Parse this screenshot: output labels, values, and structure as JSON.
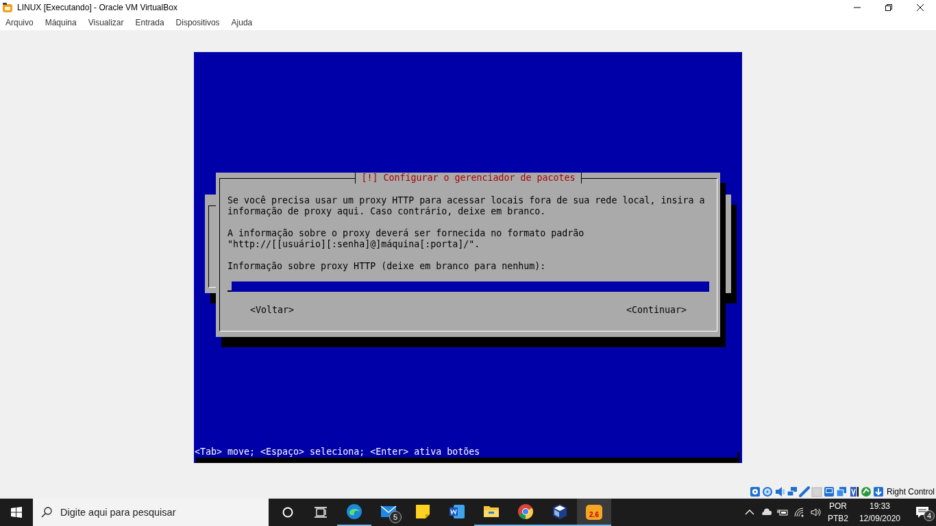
{
  "window": {
    "title": "LINUX [Executando] - Oracle VM VirtualBox"
  },
  "menu": [
    "Arquivo",
    "Máquina",
    "Visualizar",
    "Entrada",
    "Dispositivos",
    "Ajuda"
  ],
  "installer": {
    "title": "[!] Configurar o gerenciador de pacotes",
    "paragraphs": [
      "Se você precisa usar um proxy HTTP para acessar locais fora de sua rede local, insira a\ninformação de proxy aqui. Caso contrário, deixe em branco.",
      "A informação sobre o proxy deverá ser fornecida no formato padrão\n\"http://[[usuário][:senha]@]máquina[:porta]/\"."
    ],
    "field_label": "Informação sobre proxy HTTP (deixe em branco para nenhum):",
    "buttons": [
      "<Voltar>",
      "<Continuar>"
    ],
    "help": "<Tab> move; <Espaço> seleciona; <Enter> ativa botões"
  },
  "status_bar": {
    "host_key": "Right Control"
  },
  "taskbar": {
    "search": {
      "placeholder": "Digite aqui para pesquisar"
    },
    "apps": [
      {
        "running": true,
        "selected": false
      },
      {
        "running": false,
        "selected": false,
        "badge": "5"
      },
      {
        "running": false,
        "selected": false
      },
      {
        "running": false,
        "selected": false
      },
      {
        "running": true,
        "selected": false
      },
      {
        "running": true,
        "selected": false
      },
      {
        "running": true,
        "selected": false
      },
      {
        "running": true,
        "selected": true,
        "label": "2.6"
      }
    ],
    "language": "POR",
    "layout": "PTB2",
    "time": "19:33",
    "date": "12/09/2020",
    "notifications": "4"
  }
}
